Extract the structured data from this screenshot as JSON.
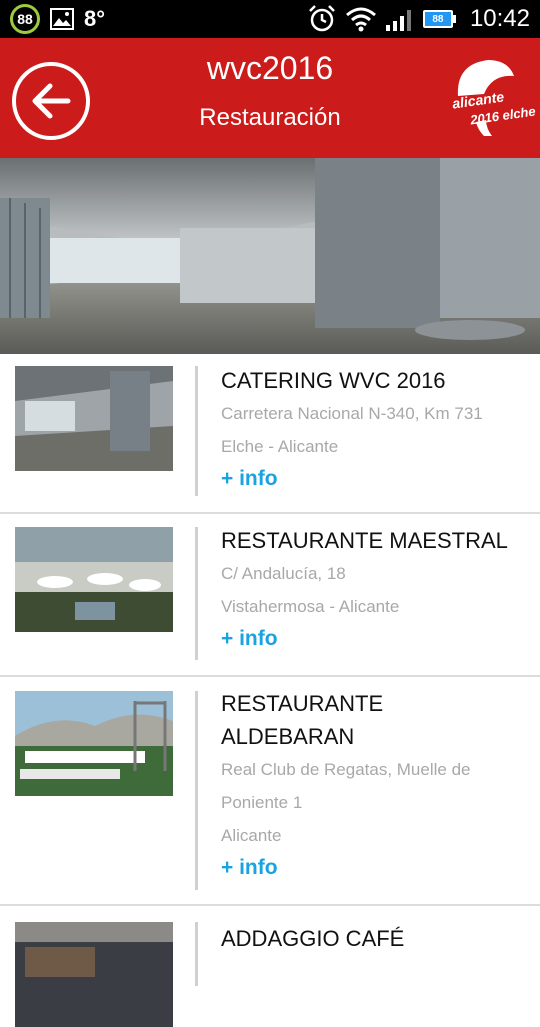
{
  "status_bar": {
    "badge": "88",
    "temperature": "8°",
    "battery": "88",
    "time": "10:42"
  },
  "header": {
    "title": "wvc2016",
    "subtitle": "Restauración",
    "logo_line1": "alicante",
    "logo_line2": "2016 elche"
  },
  "colors": {
    "header_bg": "#cc1b1b",
    "info_link": "#1aa3e0",
    "address_text": "#a8a8a8"
  },
  "items": [
    {
      "title": "CATERING WVC 2016",
      "address_lines": [
        "Carretera Nacional N-340, Km 731",
        "Elche - Alicante"
      ],
      "info": "+ info"
    },
    {
      "title": "RESTAURANTE MAESTRAL",
      "address_lines": [
        "C/ Andalucía, 18",
        "Vistahermosa - Alicante"
      ],
      "info": "+ info"
    },
    {
      "title_lines": [
        "RESTAURANTE",
        "ALDEBARAN"
      ],
      "address_lines": [
        "Real Club de Regatas, Muelle de",
        "Poniente 1",
        "Alicante"
      ],
      "info": "+ info"
    },
    {
      "title": "ADDAGGIO CAFÉ"
    }
  ]
}
